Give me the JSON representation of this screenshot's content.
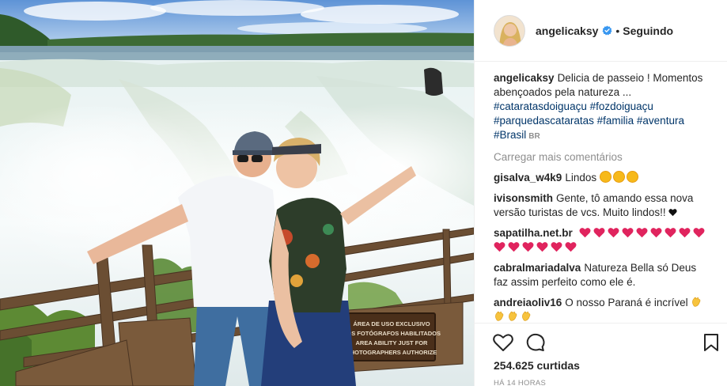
{
  "post": {
    "account": {
      "username": "angelicaksy",
      "verified": true,
      "separator": "•",
      "follow_label": "Seguindo"
    },
    "photo": {
      "sign_lines": [
        "ÁREA DE USO EXCLUSIVO",
        "DOS FOTÓGRAFOS HABILITADOS",
        "AREA ABILITY JUST FOR",
        "PHOTOGRAPHERS AUTHORIZE"
      ]
    },
    "caption": {
      "username": "angelicaksy",
      "text": "Delicia de passeio ! Momentos abençoados pela natureza ...",
      "hashtags": [
        "#cataratasdoiguaçu",
        "#fozdoiguaçu",
        "#parquedascataratas",
        "#familia",
        "#aventura",
        "#Brasil"
      ],
      "flag_label": "BR"
    },
    "load_more_label": "Carregar mais comentários",
    "comments": [
      {
        "username": "gisalva_w4k9",
        "text": "Lindos"
      },
      {
        "username": "ivisonsmith",
        "text": "Gente, tô amando essa nova versão turistas de vcs. Muito lindos!!"
      },
      {
        "username": "sapatilha.net.br",
        "text": ""
      },
      {
        "username": "cabralmariadalva",
        "text": "Natureza Bella só Deus faz assim perfeito como ele é."
      },
      {
        "username": "andreiaoliv16",
        "text": "O nosso Paraná é incrível"
      }
    ],
    "actions": {
      "like_icon": "heart-outline-icon",
      "comment_icon": "speech-bubble-icon",
      "save_icon": "bookmark-icon"
    },
    "likes_label": "254.625 curtidas",
    "time_label": "HÁ 14 HORAS",
    "colors": {
      "text": "#262626",
      "muted": "#8e8e8e",
      "hashtag": "#003569",
      "verified": "#3897f0",
      "border": "#efefef"
    }
  }
}
